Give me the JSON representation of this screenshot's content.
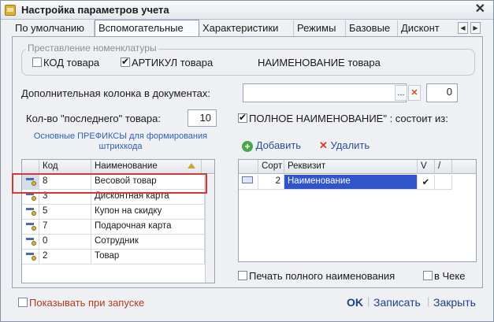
{
  "window": {
    "title": "Настройка параметров учета",
    "close_glyph": "✕"
  },
  "tabs": [
    {
      "label": "По умолчанию"
    },
    {
      "label": "Вспомогательные"
    },
    {
      "label": "Характеристики"
    },
    {
      "label": "Режимы"
    },
    {
      "label": "Базовые"
    },
    {
      "label": "Дисконт"
    }
  ],
  "tab_scroll": {
    "left": "◀",
    "right": "▶"
  },
  "nomenclature_group": {
    "title": "Преставление номенклатуры",
    "code_label": "КОД товара",
    "code_checked": false,
    "article_label": "АРТИКУЛ товара",
    "article_checked": true,
    "name_label": "НАИМЕНОВАНИЕ товара"
  },
  "extra_column": {
    "label": "Дополнительная колонка в документах:",
    "value": "",
    "dots_button": "...",
    "clear_button": "✕",
    "number": "0"
  },
  "last_count": {
    "label": "Кол-во \"последнего\" товара:",
    "value": "10"
  },
  "full_name": {
    "label": "ПОЛНОЕ НАИМЕНОВАНИЕ\" : состоит из:",
    "checked": true
  },
  "prefixes_title": "Основные ПРЕФИКСЫ для формирования штрихкода",
  "prefix_grid": {
    "headers": {
      "code": "Код",
      "name": "Наименование"
    },
    "rows": [
      {
        "code": "8",
        "name": "Весовой  товар"
      },
      {
        "code": "3",
        "name": "Дисконтная карта"
      },
      {
        "code": "5",
        "name": "Купон на скидку"
      },
      {
        "code": "7",
        "name": "Подарочная карта"
      },
      {
        "code": "0",
        "name": "Сотрудник"
      },
      {
        "code": "2",
        "name": "Товар"
      }
    ]
  },
  "actions": {
    "add": "Добавить",
    "delete": "Удалить"
  },
  "req_grid": {
    "headers": {
      "sort": "Сорт",
      "req": "Реквизит",
      "v": "V",
      "slash": "/"
    },
    "rows": [
      {
        "sort": "2",
        "req": "Наименование",
        "v": "✔"
      }
    ]
  },
  "print_full_name": {
    "label": "Печать полного наименования",
    "checked": false
  },
  "in_check": {
    "label": "в Чеке",
    "checked": false
  },
  "show_on_start": {
    "label": "Показывать при запуске",
    "checked": false
  },
  "footer": {
    "ok": "OK",
    "save": "Записать",
    "close": "Закрыть"
  },
  "colors": {
    "selection": "#2f55c9",
    "highlight_border": "#d23a3a",
    "show_start_text": "#b23b1e"
  }
}
